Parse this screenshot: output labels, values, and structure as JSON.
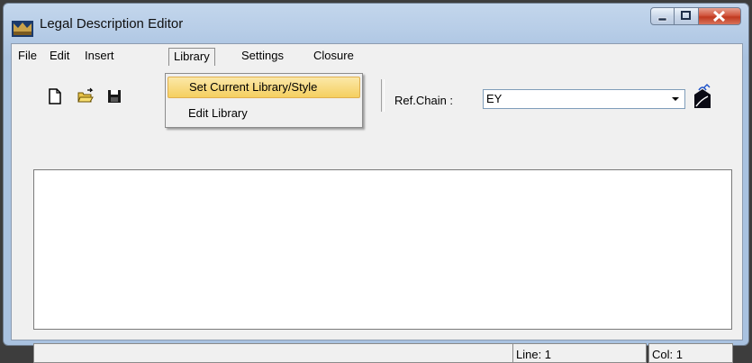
{
  "window": {
    "title": "Legal Description Editor",
    "icon": "app-logo-icon"
  },
  "caption_buttons": {
    "minimize": "minimize-icon",
    "maximize": "maximize-icon",
    "close": "close-icon"
  },
  "menu": {
    "file": "File",
    "edit": "Edit",
    "insert": "Insert",
    "library": "Library",
    "settings": "Settings",
    "closure": "Closure"
  },
  "library_menu": {
    "set_current": "Set Current Library/Style",
    "edit_library": "Edit Library"
  },
  "toolbar": {
    "new_icon": "new-document-icon",
    "open_icon": "open-folder-icon",
    "save_icon": "save-disk-icon",
    "refchain_label": "Ref.Chain :",
    "refchain_value": "EY",
    "chain_tool_icon": "chain-tool-icon"
  },
  "status": {
    "message": "",
    "line": "Line: 1",
    "col": "Col: 1"
  },
  "colors": {
    "frame": "#b7cde7",
    "highlight": "#f5cf60",
    "close_button": "#c0391f"
  }
}
